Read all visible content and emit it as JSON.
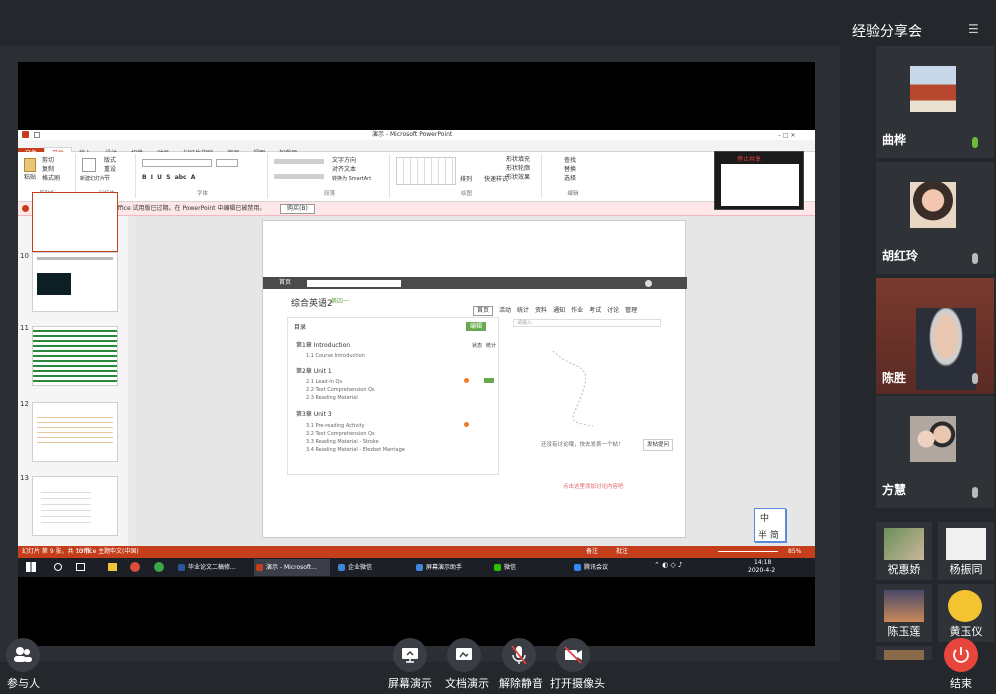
{
  "meeting": {
    "title": "经验分享会",
    "participants_label": "参与人",
    "controls": {
      "screen_share": "屏幕演示",
      "doc_share": "文档演示",
      "unmute": "解除静音",
      "camera_on": "打开摄像头",
      "end": "结束"
    },
    "participants": [
      {
        "name": "曲桦",
        "mic": "on"
      },
      {
        "name": "胡红玲",
        "mic": "off"
      },
      {
        "name": "陈胜",
        "mic": "off"
      },
      {
        "name": "方慧",
        "mic": "off"
      }
    ],
    "small_participants": [
      "祝惠娇",
      "杨振同",
      "陈玉莲",
      "黄玉仪"
    ]
  },
  "ppt": {
    "window_title": "演示 - Microsoft PowerPoint",
    "tabs": [
      "文件",
      "开始",
      "插入",
      "设计",
      "切换",
      "动画",
      "幻灯片放映",
      "审阅",
      "视图",
      "加载项"
    ],
    "groups": [
      "剪贴板",
      "幻灯片",
      "字体",
      "段落",
      "绘图",
      "编辑"
    ],
    "buttons": {
      "paste": "粘贴",
      "cut": "剪切",
      "copy": "复制",
      "format_painter": "格式刷",
      "new_slide": "新建幻灯片",
      "layout": "版式",
      "reset": "重设",
      "section": "节",
      "text_direction": "文字方向",
      "align_text": "对齐文本",
      "smartart": "转换为 SmartArt",
      "arrange": "排列",
      "quick_styles": "快速样式",
      "shape_fill": "形状填充",
      "shape_outline": "形状轮廓",
      "shape_effects": "形状效果",
      "find": "查找",
      "replace": "替换",
      "select": "选择"
    },
    "notice": "试用版已过期。由 Microsoft Office 试用版已过期。在 PowerPoint 中编辑已被禁用。",
    "notice_button": "购买(B)",
    "slide_numbers": [
      "10",
      "11",
      "12",
      "13"
    ],
    "status": {
      "slide": "幻灯片 第 9 张，共 13 张",
      "theme": "\"Office 主题\"",
      "lang": "中文(中国)",
      "notes": "备注",
      "comments": "批注",
      "zoom": "85%"
    }
  },
  "webpage": {
    "nav_home": "首页",
    "course_title": "综合英语2",
    "course_sub": "第四一",
    "tabs": [
      "首页",
      "活动",
      "统计",
      "资料",
      "通知",
      "作业",
      "考试",
      "讨论",
      "管理"
    ],
    "toc_title": "目录",
    "edit_button": "编辑",
    "col_status": "状态",
    "col_stats": "统计",
    "search_placeholder": "请输入",
    "chapters": [
      {
        "title": "第1章 Introduction",
        "items": [
          "1.1 Course Introduction"
        ]
      },
      {
        "title": "第2章 Unit 1",
        "items": [
          "2.1 Lead-in Qs",
          "2.2 Text Comprehension Qs",
          "2.3 Reading Material"
        ]
      },
      {
        "title": "第3章 Unit 3",
        "items": [
          "3.1 Pre-reading Activity",
          "3.2 Text Comprehension Qs",
          "3.3 Reading Material - Stroke",
          "3.4 Reading Material - Elezbet Marriage"
        ]
      }
    ],
    "empty_hint": "还没有讨论哦，快去发表一个帖！",
    "post_button": "发帖提问",
    "red_hint": "点击这里添加讨论内容吧",
    "ime": {
      "line1": "中",
      "line2": "半",
      "line3": "简"
    }
  },
  "taskbar": {
    "items": [
      "毕业论文二稿修...",
      "演示 - Microsoft...",
      "企业微信",
      "屏幕演示助手",
      "微信",
      "腾讯会议"
    ],
    "time": "14:18",
    "date": "2020-4-2"
  },
  "recording": {
    "label": "停止共享"
  }
}
